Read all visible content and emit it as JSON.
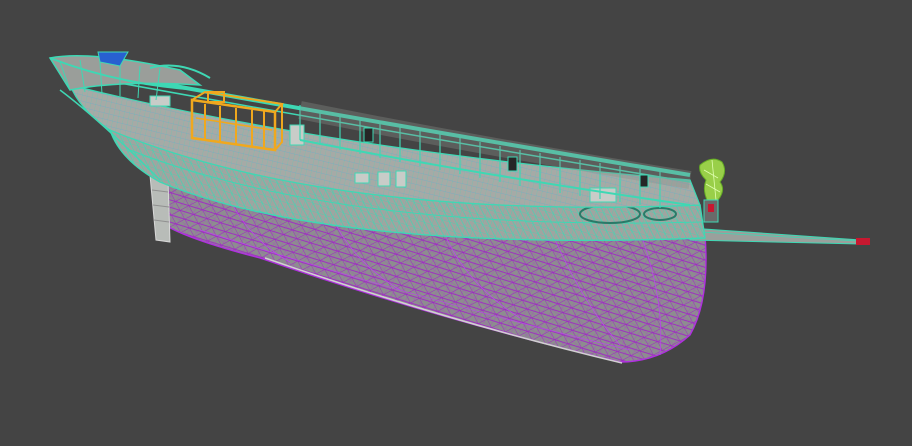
{
  "viewport": {
    "background_color": "#444444",
    "object": "sailing-ship-hull-model",
    "display_mode": "wireframe-on-shaded"
  },
  "colors": {
    "hull_wire": "#a020c8",
    "hull_fill": "#8d8d8f",
    "deck_wire": "#3ed8b4",
    "deck_fill": "#a6aaa6",
    "deckhouse_wire": "#f0a81e",
    "figurehead_wire": "#a8e84a",
    "stern_accent": "#2860d0",
    "selection_red": "#c81830"
  }
}
